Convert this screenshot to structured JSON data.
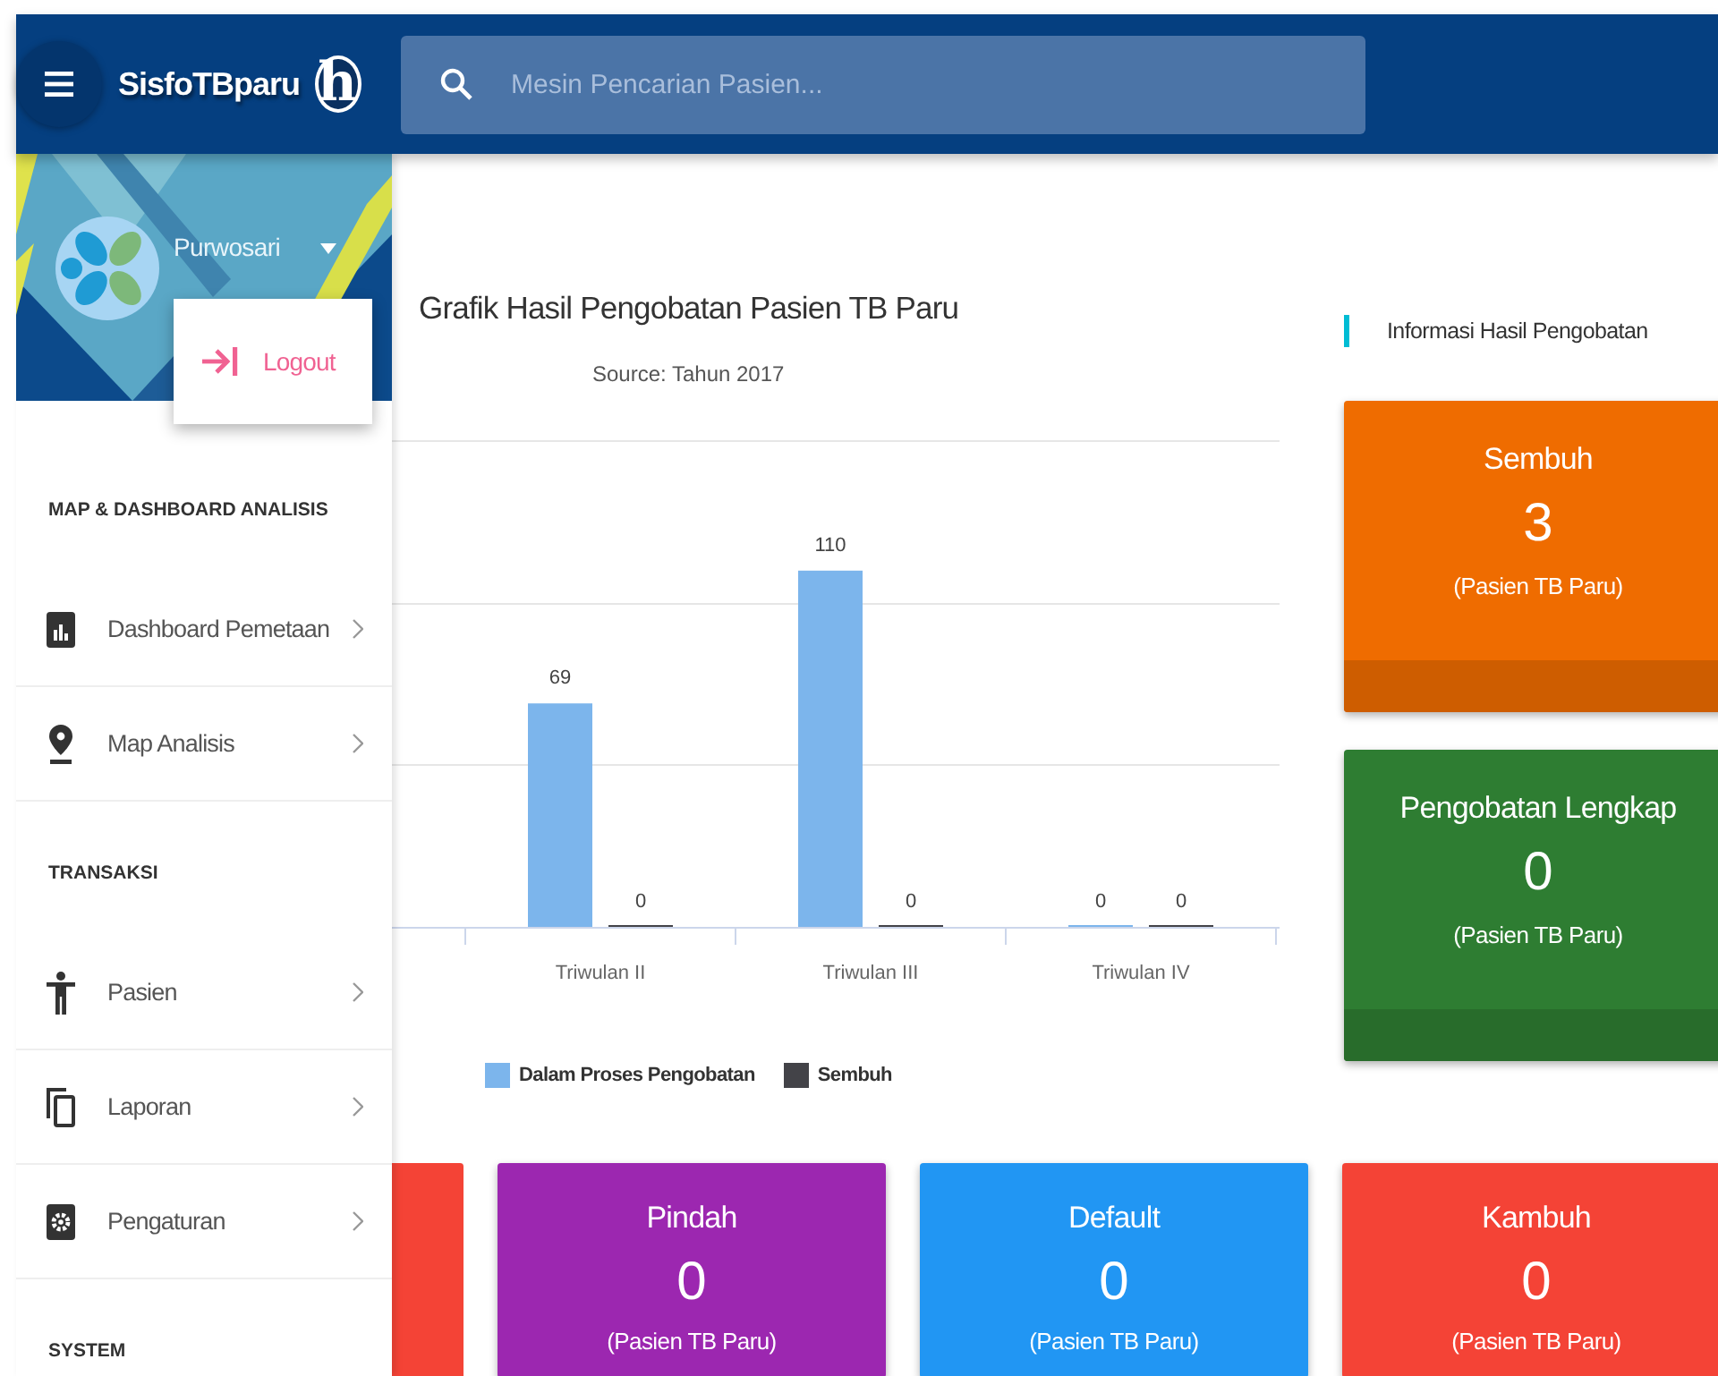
{
  "top_bar": {
    "app_title": "SisfoTBparu",
    "logo_mark": "h",
    "search": {
      "placeholder": "Mesin Pencarian Pasien..."
    }
  },
  "sidebar": {
    "user": {
      "name": "Purwosari",
      "expanded": true
    },
    "dropdown": [
      {
        "label": "Logout"
      }
    ],
    "sections": [
      {
        "title": "MAP & DASHBOARD ANALISIS",
        "items": [
          {
            "label": "Dashboard Pemetaan"
          },
          {
            "label": "Map Analisis"
          }
        ]
      },
      {
        "title": "TRANSAKSI",
        "items": [
          {
            "label": "Pasien"
          },
          {
            "label": "Laporan"
          },
          {
            "label": "Pengaturan"
          }
        ]
      },
      {
        "title": "SYSTEM"
      }
    ]
  },
  "chart": {
    "subtitle": "Source: Tahun 2017",
    "chart_data": {
      "type": "bar",
      "title": "Grafik Hasil Pengobatan Pasien TB Paru",
      "categories": [
        "Triwulan II",
        "Triwulan III",
        "Triwulan IV"
      ],
      "series": [
        {
          "name": "Dalam Proses Pengobatan",
          "color": "#7cb5ec",
          "values": [
            69,
            110,
            0
          ]
        },
        {
          "name": "Sembuh",
          "color": "#434348",
          "values": [
            0,
            0,
            0
          ]
        }
      ],
      "legend": "bottom",
      "data_labels": true
    }
  },
  "info": {
    "heading": "Informasi Hasil Pengobatan",
    "cards": [
      {
        "title": "Sembuh",
        "value": "3",
        "unit": "(Pasien TB Paru)",
        "color": "#ef6c00"
      },
      {
        "title": "Pengobatan Lengkap",
        "value": "0",
        "unit": "(Pasien TB Paru)",
        "color": "#2e7d32"
      }
    ]
  },
  "bottom_cards": [
    {
      "kind": "partial",
      "color": "#f44336"
    },
    {
      "kind": "stat",
      "title": "Pindah",
      "value": "0",
      "unit": "(Pasien TB Paru)",
      "color": "#9c27b0"
    },
    {
      "kind": "stat",
      "title": "Default",
      "value": "0",
      "unit": "(Pasien TB Paru)",
      "color": "#2196f3"
    },
    {
      "kind": "stat",
      "title": "Kambuh",
      "value": "0",
      "unit": "(Pasien TB Paru)",
      "color": "#f44336"
    }
  ]
}
